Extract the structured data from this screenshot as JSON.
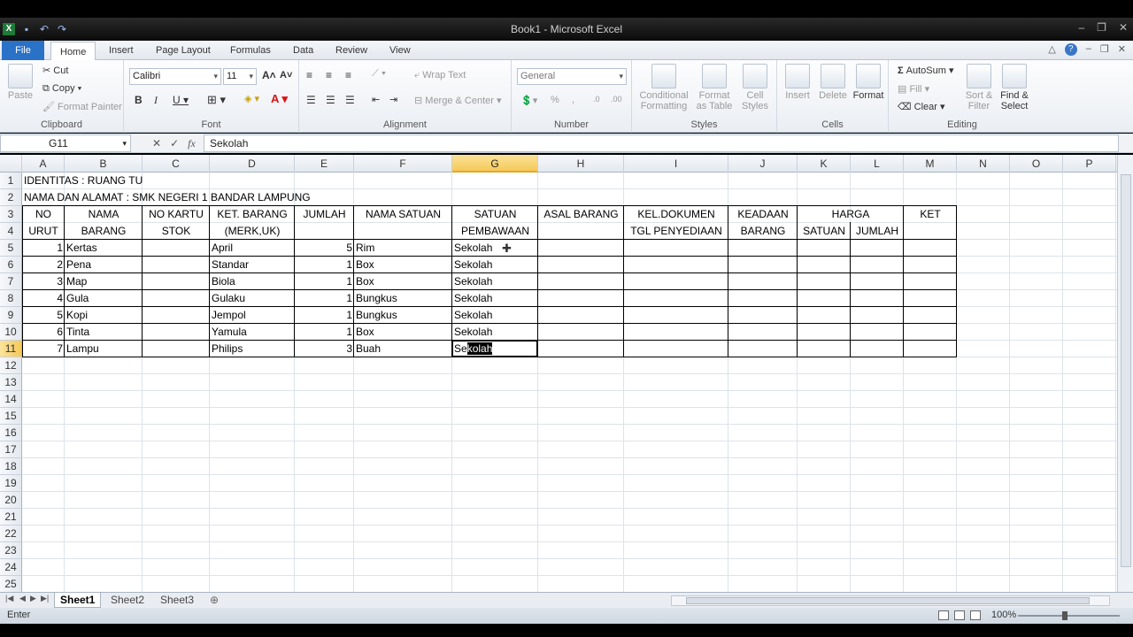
{
  "window": {
    "title": "Book1 - Microsoft Excel"
  },
  "ribbon_tabs": {
    "file": "File",
    "tabs": [
      "Home",
      "Insert",
      "Page Layout",
      "Formulas",
      "Data",
      "Review",
      "View"
    ]
  },
  "clipboard": {
    "paste": "Paste",
    "cut": "Cut",
    "copy": "Copy",
    "format_painter": "Format Painter",
    "label": "Clipboard"
  },
  "font": {
    "name": "Calibri",
    "size": "11",
    "label": "Font"
  },
  "alignment": {
    "wrap": "Wrap Text",
    "merge": "Merge & Center",
    "label": "Alignment"
  },
  "number": {
    "format": "General",
    "label": "Number"
  },
  "styles": {
    "conditional": "Conditional",
    "conditional2": "Formatting",
    "format_table": "Format",
    "format_table2": "as Table",
    "cell_styles": "Cell",
    "cell_styles2": "Styles",
    "label": "Styles"
  },
  "cells_grp": {
    "insert": "Insert",
    "delete": "Delete",
    "format": "Format",
    "label": "Cells"
  },
  "editing": {
    "autosum": "AutoSum",
    "fill": "Fill",
    "clear": "Clear",
    "sort": "Sort &",
    "sort2": "Filter",
    "find": "Find &",
    "find2": "Select",
    "label": "Editing"
  },
  "formula_bar": {
    "name_box": "G11",
    "content": "Sekolah"
  },
  "columns": [
    "A",
    "B",
    "C",
    "D",
    "E",
    "F",
    "G",
    "H",
    "I",
    "J",
    "K",
    "L",
    "M",
    "N",
    "O",
    "P"
  ],
  "selected_column": "G",
  "rows": [
    "1",
    "2",
    "3",
    "4",
    "5",
    "6",
    "7",
    "8",
    "9",
    "10",
    "11",
    "12",
    "13",
    "14",
    "15",
    "16",
    "17",
    "18",
    "19",
    "20",
    "21",
    "22",
    "23",
    "24",
    "25"
  ],
  "selected_row": "11",
  "sheet": {
    "r1": "IDENTITAS : RUANG TU",
    "r2": "NAMA DAN ALAMAT : SMK NEGERI 1 BANDAR LAMPUNG",
    "header1": [
      "NO",
      "NAMA",
      "NO KARTU",
      "KET. BARANG",
      "JUMLAH",
      "NAMA SATUAN",
      "SATUAN",
      "ASAL BARANG",
      "KEL.DOKUMEN",
      "KEADAAN",
      "HARGA",
      "KET"
    ],
    "header2": [
      "URUT",
      "BARANG",
      "STOK",
      "(MERK,UK)",
      "",
      "",
      "PEMBAWAAN",
      "",
      "TGL PENYEDIAAN",
      "BARANG",
      "SATUAN",
      "JUMLAH"
    ],
    "data": [
      {
        "no": "1",
        "nama": "Kertas",
        "ket": "April",
        "jumlah": "5",
        "satuan": "Rim",
        "asal": "Sekolah"
      },
      {
        "no": "2",
        "nama": "Pena",
        "ket": "Standar",
        "jumlah": "1",
        "satuan": "Box",
        "asal": "Sekolah"
      },
      {
        "no": "3",
        "nama": "Map",
        "ket": "Biola",
        "jumlah": "1",
        "satuan": "Box",
        "asal": "Sekolah"
      },
      {
        "no": "4",
        "nama": "Gula",
        "ket": "Gulaku",
        "jumlah": "1",
        "satuan": "Bungkus",
        "asal": "Sekolah"
      },
      {
        "no": "5",
        "nama": "Kopi",
        "ket": "Jempol",
        "jumlah": "1",
        "satuan": "Bungkus",
        "asal": "Sekolah"
      },
      {
        "no": "6",
        "nama": "Tinta",
        "ket": "Yamula",
        "jumlah": "1",
        "satuan": "Box",
        "asal": "Sekolah"
      },
      {
        "no": "7",
        "nama": "Lampu",
        "ket": "Philips",
        "jumlah": "3",
        "satuan": "Buah",
        "asal_pre": "Se",
        "asal_sel": "kolah"
      }
    ]
  },
  "sheet_tabs": [
    "Sheet1",
    "Sheet2",
    "Sheet3"
  ],
  "status": {
    "mode": "Enter",
    "zoom": "100%"
  }
}
